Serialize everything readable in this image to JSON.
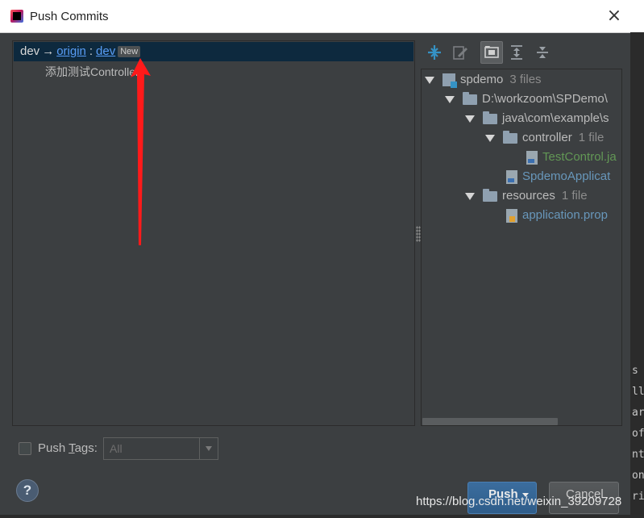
{
  "window": {
    "title": "Push Commits",
    "close_glyph": "×"
  },
  "push_list": {
    "local_branch": "dev",
    "arrow": "→",
    "remote": "origin",
    "colon": ":",
    "remote_branch": "dev",
    "badge": "New",
    "commits": [
      {
        "message": "添加测试Controller"
      }
    ]
  },
  "toolbar": {
    "buttons": [
      {
        "icon": "expand-diff-icon"
      },
      {
        "icon": "edit-source-icon"
      },
      {
        "icon": "group-by-directory-icon",
        "active": true
      },
      {
        "icon": "expand-all-icon"
      },
      {
        "icon": "collapse-all-icon"
      }
    ]
  },
  "tree": {
    "nodes": [
      {
        "label": "spdemo",
        "count": "3 files",
        "icon": "module-icon"
      },
      {
        "label": "D:\\workzoom\\SPDemo\\",
        "icon": "folder-icon"
      },
      {
        "label": "java\\com\\example\\s",
        "icon": "folder-icon"
      },
      {
        "label": "controller",
        "count": "1 file",
        "icon": "folder-icon"
      },
      {
        "label": "TestControl.ja",
        "icon": "java-file-icon",
        "color": "#629755"
      },
      {
        "label": "SpdemoApplicat",
        "icon": "java-file-icon",
        "color": "#6897bb"
      },
      {
        "label": "resources",
        "count": "1 file",
        "icon": "folder-icon"
      },
      {
        "label": "application.prop",
        "icon": "properties-file-icon",
        "color": "#6897bb"
      }
    ]
  },
  "footer": {
    "push_tags_label_pre": "Push ",
    "push_tags_label_mnemonic": "T",
    "push_tags_label_post": "ags:",
    "tags_select_value": "All",
    "help_label": "?",
    "push_label": "Push",
    "cancel_label": "Cancel"
  },
  "background": {
    "code_fragments": [
      "s",
      "ll",
      "ar",
      "of",
      "nt",
      "on",
      "ri"
    ]
  },
  "watermark": "https://blog.csdn.net/weixin_39209728",
  "colors": {
    "selection": "#0d293e",
    "link": "#589df6",
    "modified_file": "#629755",
    "unchanged_file": "#6897bb",
    "annotation_arrow": "#ff1a1a",
    "primary_button": "#365f8c"
  }
}
